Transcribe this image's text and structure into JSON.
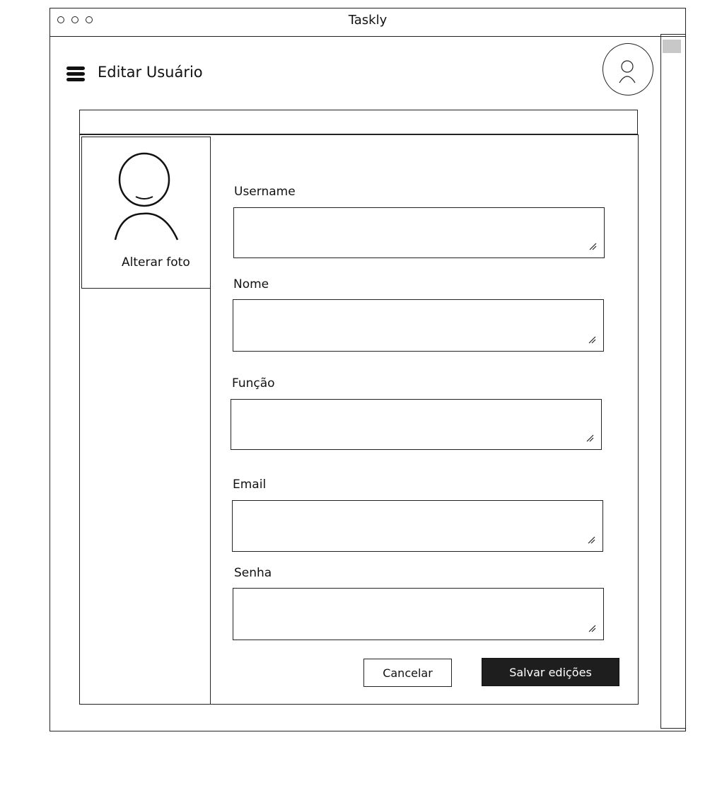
{
  "window": {
    "title": "Taskly"
  },
  "header": {
    "title": "Editar Usuário",
    "menu_icon": "menu-icon",
    "avatar_icon": "user-avatar-icon"
  },
  "sidebar": {
    "change_photo_label": "Alterar foto",
    "photo_icon": "user-silhouette-icon"
  },
  "form": {
    "fields": [
      {
        "label": "Username",
        "value": ""
      },
      {
        "label": "Nome",
        "value": ""
      },
      {
        "label": "Função",
        "value": ""
      },
      {
        "label": "Email",
        "value": ""
      },
      {
        "label": "Senha",
        "value": ""
      }
    ]
  },
  "actions": {
    "cancel_label": "Cancelar",
    "save_label": "Salvar edições"
  },
  "colors": {
    "primary_button_bg": "#1e1e1e",
    "primary_button_text": "#ffffff",
    "scroll_thumb": "#c8c8c8"
  }
}
